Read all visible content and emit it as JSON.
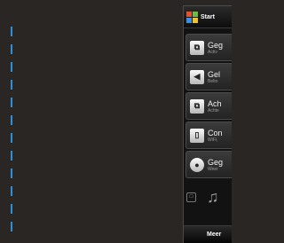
{
  "start_bar": {
    "label": "Start"
  },
  "tiles": [
    {
      "title": "Geg",
      "subtitle": "Activ",
      "icon": "data-icon",
      "glyph": "⧉"
    },
    {
      "title": "Gel",
      "subtitle": "Belto",
      "icon": "speaker-icon",
      "glyph": "◀"
    },
    {
      "title": "Ach",
      "subtitle": "Achte",
      "icon": "wallpaper-icon",
      "glyph": "⧉"
    },
    {
      "title": "Con",
      "subtitle": "WiFi,",
      "icon": "phone-icon",
      "glyph": "▯"
    },
    {
      "title": "Geg",
      "subtitle": "Weer",
      "icon": "location-icon",
      "glyph": "●"
    }
  ],
  "media": {
    "music_icon": "music-note-icon",
    "glyph": "♫"
  },
  "soft_key": {
    "label": "Meer"
  },
  "colors": {
    "accent_dash": "#2f8fd6",
    "background": "#2a2624"
  }
}
